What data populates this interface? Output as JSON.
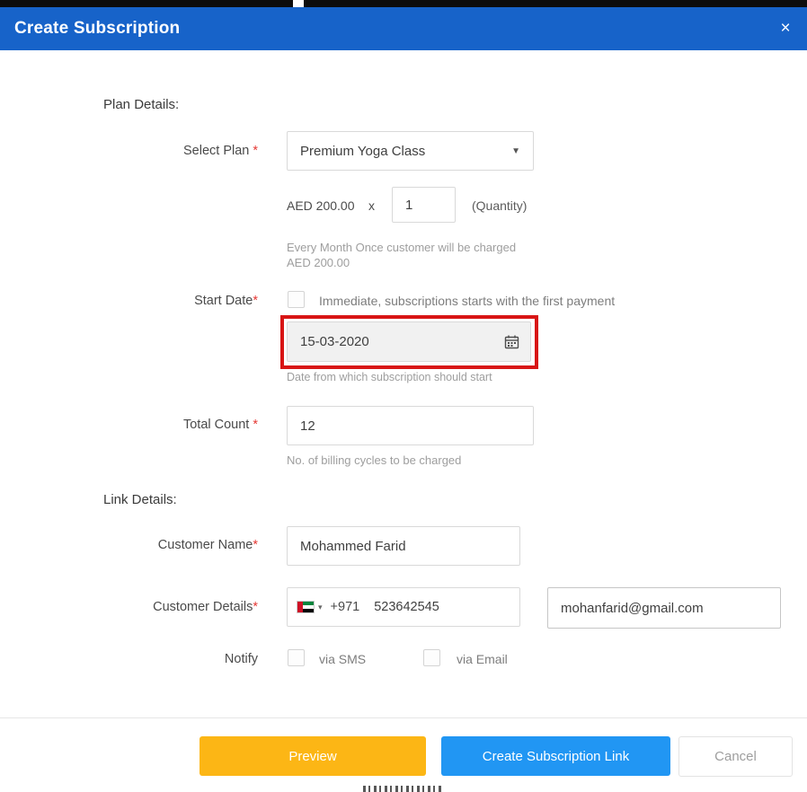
{
  "modal": {
    "title": "Create Subscription",
    "close_icon": "×"
  },
  "plan_details": {
    "section_title": "Plan Details:",
    "select_plan": {
      "label": "Select Plan",
      "required": "*",
      "value": "Premium Yoga Class",
      "caret": "▼"
    },
    "pricing": {
      "amount": "AED 200.00",
      "multiplier": "x",
      "quantity": "1",
      "quantity_hint": "(Quantity)",
      "helper": "Every Month Once customer will be charged AED 200.00"
    },
    "start_date": {
      "label": "Start Date",
      "required": "*",
      "immediate_label": "Immediate, subscriptions starts with the first payment",
      "value": "15-03-2020",
      "helper": "Date from which subscription should start"
    },
    "total_count": {
      "label": "Total Count",
      "required": "*",
      "value": "12",
      "helper": "No. of billing cycles to be charged"
    }
  },
  "link_details": {
    "section_title": "Link Details:",
    "customer_name": {
      "label": "Customer Name",
      "required": "*",
      "value": "Mohammed Farid"
    },
    "customer_details": {
      "label": "Customer Details",
      "required": "*",
      "country_caret": "▾",
      "country_code": "+971",
      "phone": "523642545",
      "email": "mohanfarid@gmail.com"
    },
    "notify": {
      "label": "Notify",
      "sms_label": "via SMS",
      "email_label": "via Email"
    }
  },
  "footer": {
    "preview": "Preview",
    "create": "Create Subscription Link",
    "cancel": "Cancel"
  },
  "colors": {
    "header_blue": "#1763c9",
    "preview_yellow": "#fcb615",
    "create_blue": "#2196f3",
    "annotation_red": "#d81515",
    "required_red": "#e53935"
  }
}
